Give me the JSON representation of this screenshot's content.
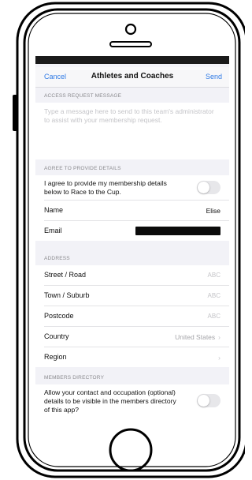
{
  "navbar": {
    "cancel_label": "Cancel",
    "title": "Athletes and Coaches",
    "send_label": "Send"
  },
  "access_request": {
    "header": "ACCESS REQUEST MESSAGE",
    "placeholder": "Type a message here to send to this team's administrator to assist with your membership request."
  },
  "agree": {
    "header": "AGREE TO PROVIDE DETAILS",
    "consent_text": "I agree to provide my membership details below to Race to the Cup.",
    "consent_on": false,
    "name_label": "Name",
    "name_value": "Elise",
    "email_label": "Email"
  },
  "address": {
    "header": "ADDRESS",
    "street_label": "Street / Road",
    "street_placeholder": "ABC",
    "town_label": "Town / Suburb",
    "town_placeholder": "ABC",
    "postcode_label": "Postcode",
    "postcode_placeholder": "ABC",
    "country_label": "Country",
    "country_value": "United States",
    "region_label": "Region"
  },
  "members_directory": {
    "header": "MEMBERS DIRECTORY",
    "visibility_text": "Allow your contact and occupation (optional) details to be visible in the members directory of this app?",
    "visibility_on": false
  },
  "icons": {
    "chevron": "chevron-right-icon",
    "speaker": "speaker-icon",
    "home_button": "home-button"
  },
  "colors": {
    "accent": "#2f7ae5",
    "background": "#f2f2f7",
    "placeholder": "#c4c4c8"
  }
}
